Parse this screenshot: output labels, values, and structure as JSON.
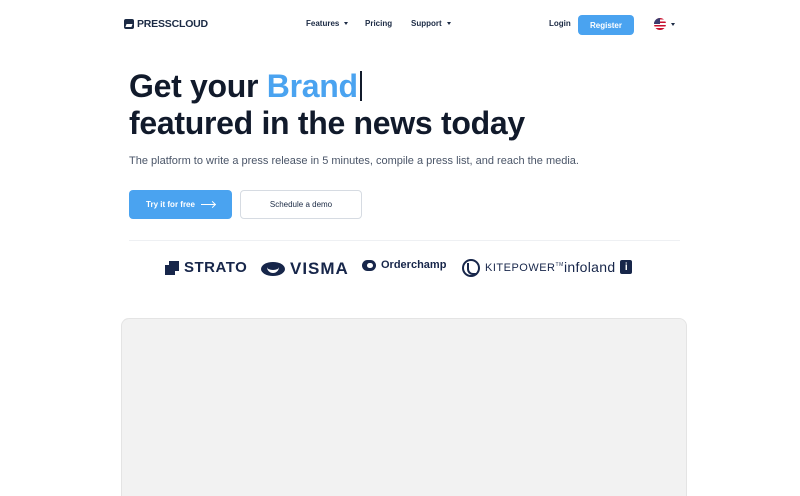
{
  "nav": {
    "logo_text": "PRESSCLOUD",
    "menu": [
      {
        "label": "Features",
        "has_dropdown": true
      },
      {
        "label": "Pricing",
        "has_dropdown": false
      },
      {
        "label": "Support",
        "has_dropdown": true
      }
    ],
    "login_label": "Login",
    "register_label": "Register",
    "language_icon": "us-flag-icon"
  },
  "hero": {
    "headline_prefix": "Get your ",
    "headline_highlight": "Brand",
    "headline_line2": "featured in the news today",
    "subtitle": "The platform to write a press release in 5 minutes, compile a press list, and reach the media.",
    "cta_primary": "Try it for free",
    "cta_secondary": "Schedule a demo"
  },
  "partners": {
    "strato": "STRATO",
    "visma": "VISMA",
    "orderchamp": "Orderchamp",
    "kitepower": "KITEPOWER",
    "kitepower_tm": "TM",
    "infoland": "infoland",
    "infoland_mark": "i"
  },
  "colors": {
    "accent": "#4aa3f0",
    "text_dark": "#111a2b",
    "preview_bg": "#f2f2f2"
  }
}
